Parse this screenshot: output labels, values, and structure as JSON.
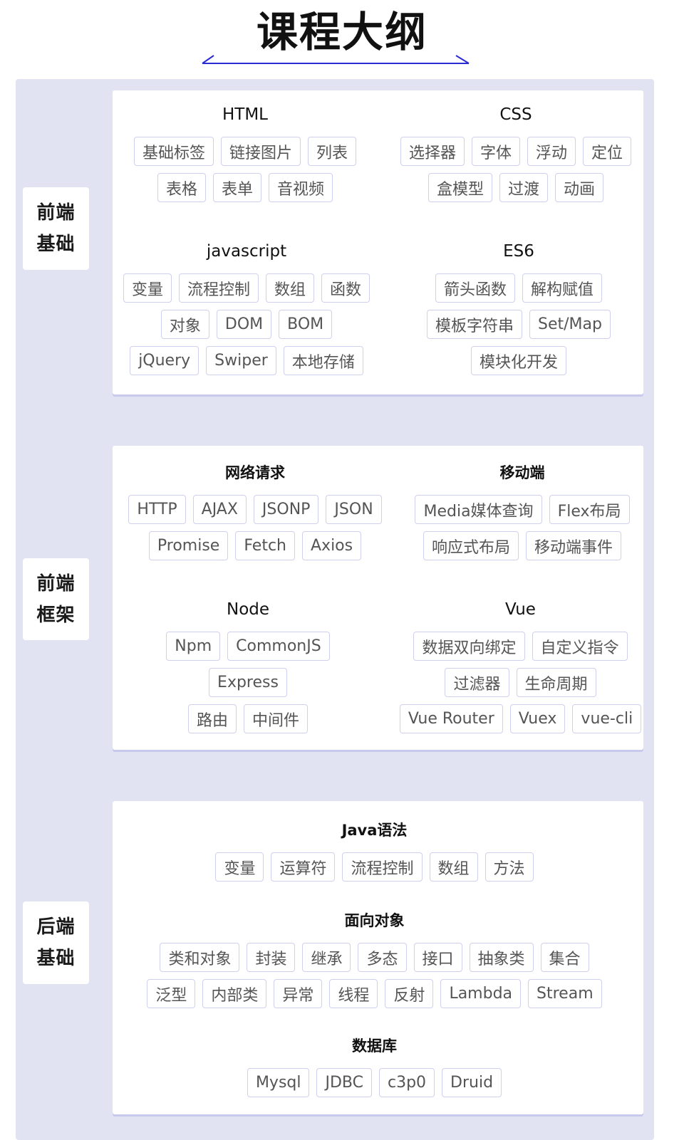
{
  "page_title": "课程大纲",
  "accent_color": "#2b2bd6",
  "sections": [
    {
      "label_line1": "前端",
      "label_line2": "基础",
      "groups": [
        {
          "title": "HTML",
          "rows": [
            [
              "基础标签",
              "链接图片",
              "列表"
            ],
            [
              "表格",
              "表单",
              "音视频"
            ]
          ]
        },
        {
          "title": "CSS",
          "rows": [
            [
              "选择器",
              "字体",
              "浮动",
              "定位"
            ],
            [
              "盒模型",
              "过渡",
              "动画"
            ]
          ]
        },
        {
          "title": "javascript",
          "rows": [
            [
              "变量",
              "流程控制",
              "数组",
              "函数"
            ],
            [
              "对象",
              "DOM",
              "BOM"
            ],
            [
              "jQuery",
              "Swiper",
              "本地存储"
            ]
          ]
        },
        {
          "title": "ES6",
          "rows": [
            [
              "箭头函数",
              "解构赋值"
            ],
            [
              "模板字符串",
              "Set/Map"
            ],
            [
              "模块化开发"
            ]
          ]
        }
      ]
    },
    {
      "label_line1": "前端",
      "label_line2": "框架",
      "groups": [
        {
          "title": "网络请求",
          "rows": [
            [
              "HTTP",
              "AJAX",
              "JSONP",
              "JSON"
            ],
            [
              "Promise",
              "Fetch",
              "Axios"
            ]
          ]
        },
        {
          "title": "移动端",
          "rows": [
            [
              "Media媒体查询",
              "Flex布局"
            ],
            [
              "响应式布局",
              "移动端事件"
            ]
          ]
        },
        {
          "title": "Node",
          "rows": [
            [
              "Npm",
              "CommonJS"
            ],
            [
              "Express"
            ],
            [
              "路由",
              "中间件"
            ]
          ]
        },
        {
          "title": "Vue",
          "rows": [
            [
              "数据双向绑定",
              "自定义指令"
            ],
            [
              "过滤器",
              "生命周期"
            ],
            [
              "Vue Router",
              "Vuex",
              "vue-cli"
            ]
          ]
        }
      ]
    },
    {
      "label_line1": "后端",
      "label_line2": "基础",
      "groups": [
        {
          "title": "Java语法",
          "rows": [
            [
              "变量",
              "运算符",
              "流程控制",
              "数组",
              "方法"
            ]
          ]
        },
        {
          "title": "面向对象",
          "rows": [
            [
              "类和对象",
              "封装",
              "继承",
              "多态",
              "接口",
              "抽象类",
              "集合"
            ],
            [
              "泛型",
              "内部类",
              "异常",
              "线程",
              "反射",
              "Lambda",
              "Stream"
            ]
          ]
        },
        {
          "title": "数据库",
          "rows": [
            [
              "Mysql",
              "JDBC",
              "c3p0",
              "Druid"
            ]
          ]
        }
      ]
    }
  ]
}
